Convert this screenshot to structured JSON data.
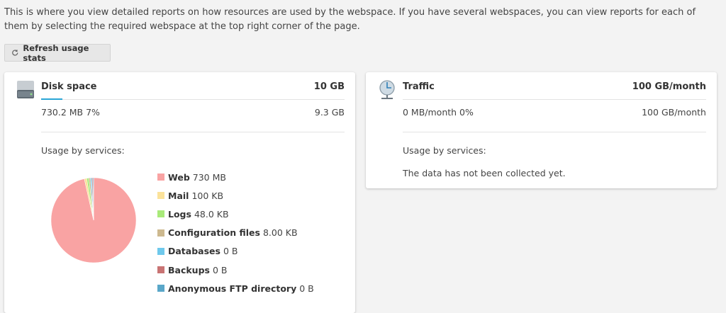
{
  "intro": "This is where you view detailed reports on how resources are used by the webspace. If you have several webspaces, you can view reports for each of them by selecting the required webspace at the top right corner of the page.",
  "refresh_button": {
    "label": "Refresh usage stats",
    "icon": "refresh-icon"
  },
  "disk": {
    "title": "Disk space",
    "limit": "10 GB",
    "used": "730.2 MB 7%",
    "used_fraction": 0.07,
    "remaining": "9.3 GB",
    "services_label": "Usage by services:",
    "icon": "hard-drive-icon",
    "accent": "#2aa6d6"
  },
  "traffic": {
    "title": "Traffic",
    "limit": "100 GB/month",
    "used": "0 MB/month 0%",
    "remaining": "100 GB/month",
    "services_label": "Usage by services:",
    "no_data": "The data has not been collected yet.",
    "icon": "globe-network-icon"
  },
  "chart_data": {
    "type": "pie",
    "slices": [
      {
        "name": "Web",
        "value_label": "730 MB",
        "color": "#f9a3a3",
        "share": 0.965
      },
      {
        "name": "Mail",
        "value_label": "100 KB",
        "color": "#fbe29a",
        "share": 0.009
      },
      {
        "name": "Logs",
        "value_label": "48.0 KB",
        "color": "#a9ea7a",
        "share": 0.008
      },
      {
        "name": "Configuration files",
        "value_label": "8.00 KB",
        "color": "#cdb98f",
        "share": 0.006
      },
      {
        "name": "Databases",
        "value_label": "0 B",
        "color": "#6fc9ec",
        "share": 0.005
      },
      {
        "name": "Backups",
        "value_label": "0 B",
        "color": "#c97474",
        "share": 0.004
      },
      {
        "name": "Anonymous FTP directory",
        "value_label": "0 B",
        "color": "#5aa7c9",
        "share": 0.003
      }
    ]
  }
}
